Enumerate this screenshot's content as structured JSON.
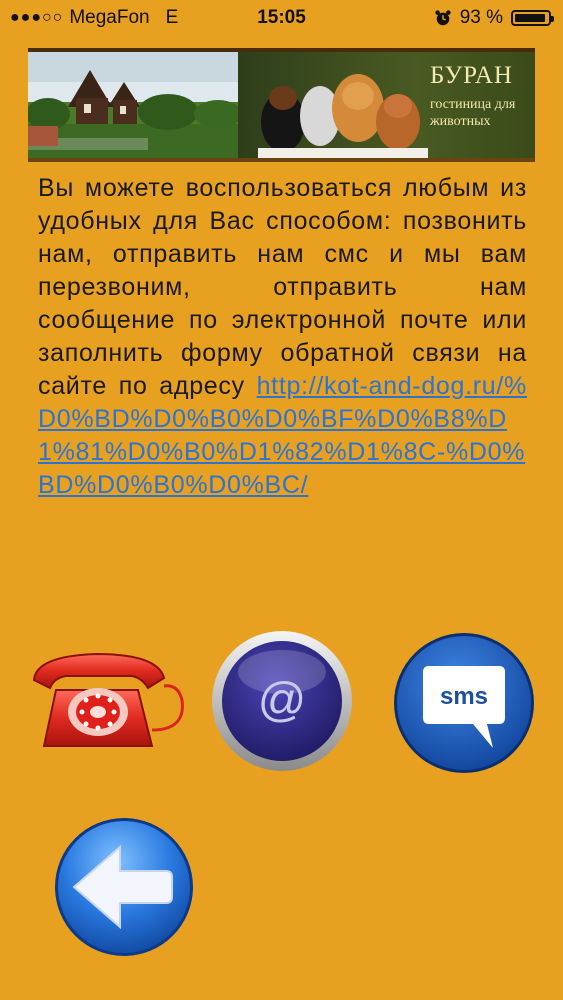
{
  "status_bar": {
    "carrier": "MegaFon",
    "network": "E",
    "time": "15:05",
    "battery_percent": "93 %",
    "battery_level": 0.93,
    "signal_bars_filled": 3,
    "signal_bars_total": 5
  },
  "banner": {
    "title": "БУРАН",
    "subtitle": "гостиница для животных"
  },
  "message": {
    "text": "Вы можете воспользоваться любым из удобных для Вас способом: позвонить нам, отправить нам смс и мы вам перезвоним, отправить нам сообщение по электронной почте или заполнить форму обратной связи на сайте по адресу ",
    "link": "http://kot-and-dog.ru/%D0%BD%D0%B0%D0%BF%D0%B8%D1%81%D0%B0%D1%82%D1%8C-%D0%BD%D0%B0%D0%BC/"
  },
  "actions": {
    "email_symbol": "@",
    "sms_label": "sms"
  },
  "colors": {
    "background": "#E8A020",
    "link": "#2a74d4",
    "phone_red": "#d8251f",
    "email_navy": "#2a2578",
    "sms_blue": "#1f63c4",
    "back_blue": "#1e6fd0"
  },
  "icons": {
    "phone": "phone-icon",
    "email": "email-icon",
    "sms": "sms-icon",
    "back": "back-arrow-icon",
    "alarm": "alarm-icon",
    "battery": "battery-icon"
  }
}
